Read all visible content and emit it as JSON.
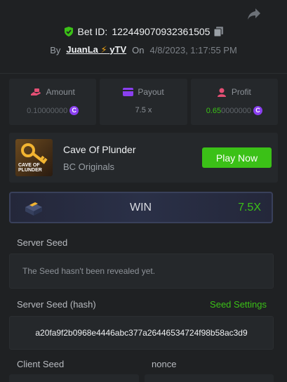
{
  "header": {
    "bet_label": "Bet ID:",
    "bet_id": "122449070932361505",
    "by_label": "By",
    "user": "JuanLa",
    "user_suffix": "yTV",
    "on_label": "On",
    "datetime": "4/8/2023, 1:17:55 PM"
  },
  "stats": [
    {
      "label": "Amount",
      "value_main": "0.1",
      "value_dim": "0000000",
      "coin": true,
      "icon": "money-hand-icon"
    },
    {
      "label": "Payout",
      "value_main": "7.5 x",
      "value_dim": "",
      "coin": false,
      "icon": "card-icon"
    },
    {
      "label": "Profit",
      "value_main": "0.65",
      "value_dim": "0000000",
      "coin": true,
      "icon": "user-profit-icon"
    }
  ],
  "game": {
    "thumb_text": "CAVE OF PLUNDER",
    "title": "Cave Of Plunder",
    "provider": "BC Originals",
    "play_label": "Play Now"
  },
  "result": {
    "label": "WIN",
    "multiplier": "7.5X"
  },
  "server_seed": {
    "label": "Server Seed",
    "placeholder": "The Seed hasn't been revealed yet."
  },
  "server_seed_hash": {
    "label": "Server Seed (hash)",
    "settings_label": "Seed Settings",
    "value": "a20fa9f2b0968e4446abc377a26446534724f98b58ac3d9"
  },
  "client_seed": {
    "label": "Client Seed"
  },
  "nonce": {
    "label": "nonce"
  },
  "colors": {
    "accent": "#3bc117",
    "coin": "#8a3ff0",
    "background": "#1f2123"
  }
}
